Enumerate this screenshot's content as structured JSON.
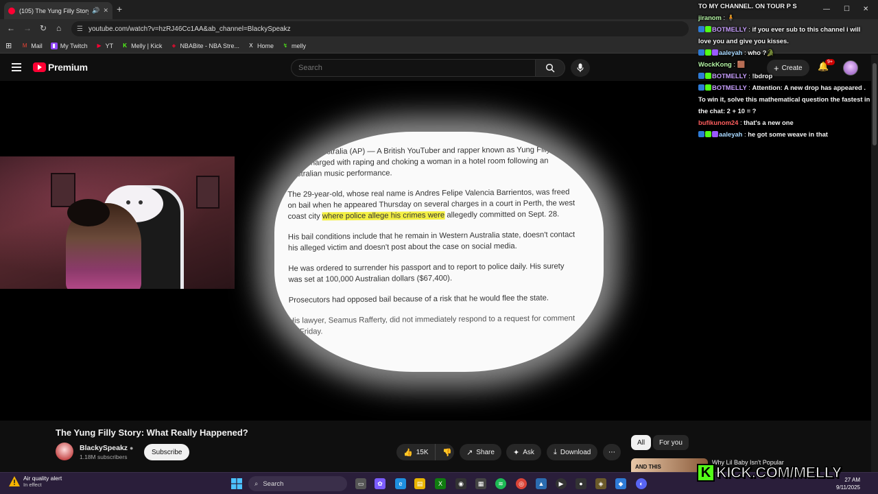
{
  "browser": {
    "tab_title": "(105) The Yung Filly Story: W",
    "url": "youtube.com/watch?v=hzRJ46Cc1AA&ab_channel=BlackySpeakz",
    "bookmarks": [
      {
        "label": "Mail",
        "icon": "gmail-icon",
        "color": "#ea4335"
      },
      {
        "label": "My Twitch",
        "icon": "twitch-icon",
        "color": "#9146ff"
      },
      {
        "label": "YT",
        "icon": "youtube-icon",
        "color": "#ff0033"
      },
      {
        "label": "Melly | Kick",
        "icon": "kick-icon",
        "color": "#53fc18"
      },
      {
        "label": "NBABite - NBA Stre...",
        "icon": "nbabite-icon",
        "color": "#c8102e"
      },
      {
        "label": "Home",
        "icon": "x-icon",
        "color": "#ffffff"
      },
      {
        "label": "melly",
        "icon": "kick-icon",
        "color": "#53fc18"
      }
    ]
  },
  "youtube": {
    "logo_text": "Premium",
    "search_placeholder": "Search",
    "create_label": "Create",
    "notif_badge": "9+"
  },
  "article": {
    "paragraphs": [
      "PERTH, Australia (AP) — A British YouTuber and rapper known as Yung Filly has been charged with raping and choking a woman in a hotel room following an Australian music performance.",
      "His bail conditions include that he remain in Western Australia state, doesn't contact his alleged victim and doesn't post about the case on social media.",
      "He was ordered to surrender his passport and to report to police daily. His surety was set at 100,000 Australian dollars ($67,400).",
      "Prosecutors had opposed bail because of a risk that he would flee the state.",
      "His lawyer, Seamus Rafferty, did not immediately respond to a request for comment on Friday."
    ],
    "p2_before": "The 29-year-old, whose real name is Andres Felipe Valencia Barrientos, was freed on bail when he appeared Thursday on several charges in a court in Perth, the west coast city ",
    "p2_highlight": "where police allege his crimes were",
    "p2_after": " allegedly committed on Sept. 28."
  },
  "video": {
    "title": "The Yung Filly Story: What Really Happened?",
    "channel": "BlackySpeakz",
    "subscribers": "1.18M subscribers",
    "subscribe_label": "Subscribe",
    "likes": "15K",
    "share_label": "Share",
    "ask_label": "Ask",
    "download_label": "Download"
  },
  "sidebar": {
    "chips": [
      "All",
      "For you"
    ],
    "rec_thumb_text": "AND THIS",
    "rec_title": "Why Lil Baby Isn't Popular"
  },
  "chat": {
    "messages": [
      {
        "user": "",
        "text": "TO MY CHANNEL. ON TOUR P S",
        "color": "#ffffff",
        "badges": []
      },
      {
        "user": "jiranom",
        "text": "🧍",
        "color": "#b5f5a5",
        "badges": []
      },
      {
        "user": "BOTMELLY",
        "text": "if you ever sub to this channel i will love you and give you kisses.",
        "color": "#c9a0ff",
        "badges": [
          "#2e7bd6",
          "#53fc18"
        ]
      },
      {
        "user": "aaleyah",
        "text": "who ?🐊",
        "color": "#a8d8ff",
        "badges": [
          "#2e7bd6",
          "#53fc18",
          "#9b59ff"
        ]
      },
      {
        "user": "WockKong",
        "text": "🟫",
        "color": "#b5f5a5",
        "badges": []
      },
      {
        "user": "BOTMELLY",
        "text": "!bdrop",
        "color": "#c9a0ff",
        "badges": [
          "#2e7bd6",
          "#53fc18"
        ]
      },
      {
        "user": "BOTMELLY",
        "text": "Attention: A new drop has appeared . To win it, solve this mathematical question the fastest in the chat: 2 + 10 = ?",
        "color": "#c9a0ff",
        "badges": [
          "#2e7bd6",
          "#53fc18"
        ]
      },
      {
        "user": "bufikunom24",
        "text": "that's a new one",
        "color": "#ff5e5e",
        "badges": []
      },
      {
        "user": "aaleyah",
        "text": "he got some weave in that",
        "color": "#a8d8ff",
        "badges": [
          "#2e7bd6",
          "#53fc18",
          "#9b59ff"
        ]
      }
    ]
  },
  "taskbar": {
    "alert_title": "Air quality alert",
    "alert_sub": "In effect",
    "search_label": "Search",
    "time": "27 AM",
    "date": "9/11/2025"
  },
  "overlay": {
    "kick_text": "KICK.COM/MELLY"
  }
}
